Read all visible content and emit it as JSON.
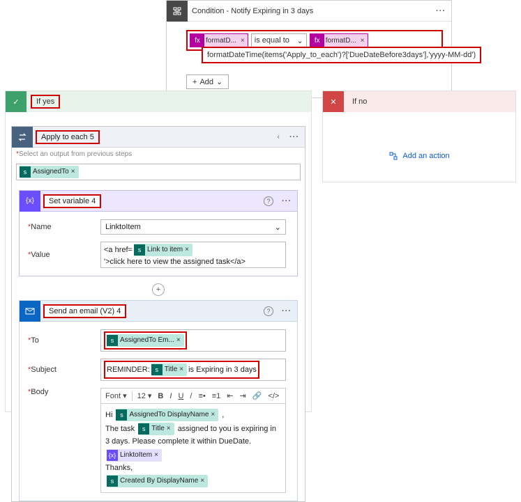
{
  "condition": {
    "title": "Condition - Notify Expiring in 3 days",
    "left_fx": "formatD...",
    "operator": "is equal to",
    "right_fx": "formatD...",
    "tooltip": "formatDateTime(items('Apply_to_each')?['DueDateBefore3days'],'yyyy-MM-dd')",
    "add": "Add"
  },
  "branches": {
    "yes": "If yes",
    "no": "If no",
    "add_action": "Add an action"
  },
  "foreach": {
    "title": "Apply to each 5",
    "subtitle": "Select an output from previous steps",
    "assigned_to": "AssignedTo"
  },
  "variable": {
    "title": "Set variable 4",
    "name_label": "Name",
    "name_value": "LinktoItem",
    "value_label": "Value",
    "value_prefix": "<a href=",
    "value_pill": "Link to item",
    "value_suffix": "'>click here to view the assigned task</a>"
  },
  "email": {
    "title": "Send an email (V2) 4",
    "to_label": "To",
    "to_pill": "AssignedTo Em...",
    "subject_label": "Subject",
    "subject_prefix": "REMINDER:",
    "subject_title": "Title",
    "subject_suffix": "is Expiring in 3 days",
    "body_label": "Body",
    "font_name": "Font",
    "font_size": "12",
    "body": {
      "hi": "Hi",
      "displayname": "AssignedTo DisplayName",
      "task_pre": "The task",
      "title": "Title",
      "task_post": "assigned to you is expiring in 3 days. Please complete it within DueDate.",
      "linkto": "LinktoItem",
      "thanks": "Thanks,",
      "createdby": "Created By DisplayName"
    }
  }
}
